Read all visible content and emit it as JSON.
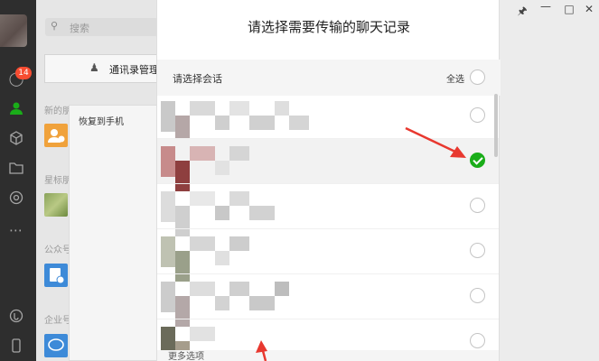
{
  "nav": {
    "badge": "14"
  },
  "search": {
    "placeholder": "搜索"
  },
  "contacts": {
    "manage_button": "通讯录管理",
    "sections": [
      "新的朋友",
      "星标朋友",
      "公众号",
      "企业号"
    ]
  },
  "popup": {
    "item": "恢复到手机"
  },
  "dialog": {
    "title": "请选择需要传输的聊天记录",
    "select_session_label": "请选择会话",
    "select_all_label": "全选",
    "footer_text": "更多选项",
    "rows": [
      {
        "checked": false,
        "swatches": [
          "#c9c9c9",
          "#b5a7a7",
          "#d9d9d9",
          "#cfcfcf",
          "#e3e3e3",
          "#d0d0d0",
          "#dedede",
          "#d5d5d5"
        ]
      },
      {
        "checked": true,
        "swatches": [
          "#c78b8b",
          "#8e3f3f",
          "#d8b4b4",
          "#e2e2e2",
          "#d5d5d5"
        ]
      },
      {
        "checked": false,
        "swatches": [
          "#dcdcdc",
          "#cfcfcf",
          "#e8e8e8",
          "#c8c8c8",
          "#dadada",
          "#d2d2d2"
        ]
      },
      {
        "checked": false,
        "swatches": [
          "#bfc2b2",
          "#9aa08a",
          "#d6d6d6",
          "#e0e0e0",
          "#cdcdcd"
        ]
      },
      {
        "checked": false,
        "swatches": [
          "#cccccc",
          "#b4a8a8",
          "#dddddd",
          "#d3d3d3",
          "#cfcfcf",
          "#c9c9c9",
          "#bdbdbd"
        ]
      },
      {
        "checked": false,
        "swatches": [
          "#6b6b5a",
          "#a69d8c",
          "#e2e2e2"
        ]
      }
    ]
  },
  "colors": {
    "accent_green": "#1aad19",
    "badge_red": "#f74c31",
    "arrow_red": "#e8382f"
  },
  "window_controls": [
    "pin-icon",
    "minimize-icon",
    "maximize-icon",
    "close-icon"
  ]
}
